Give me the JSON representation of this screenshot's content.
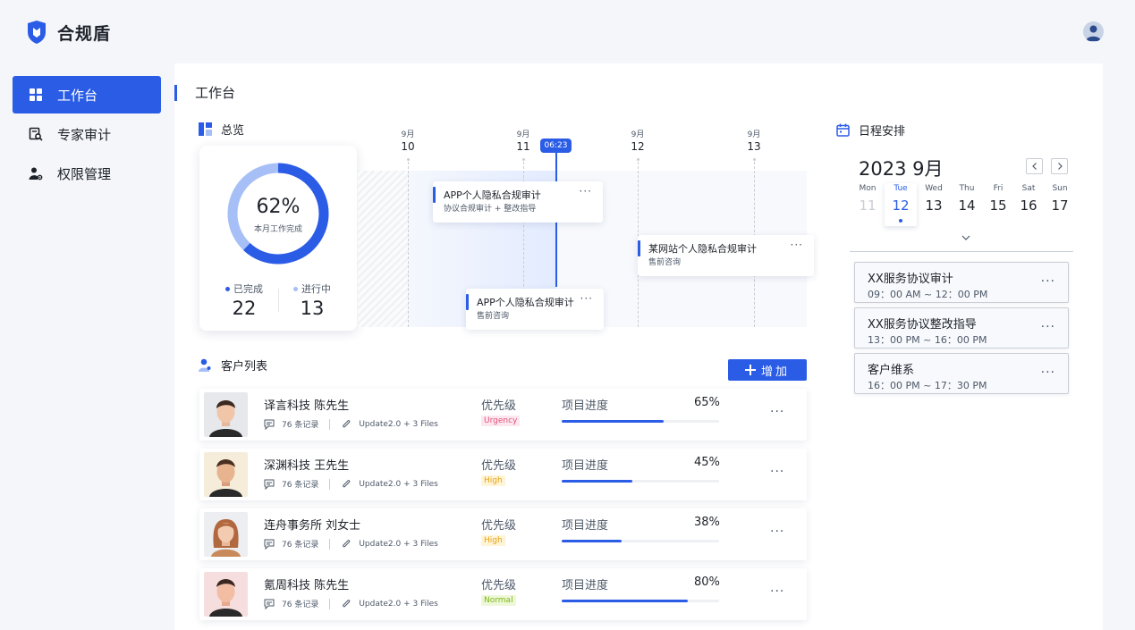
{
  "app": {
    "name": "合规盾"
  },
  "sidebar": {
    "items": [
      {
        "label": "工作台",
        "icon": "dashboard-icon",
        "active": true
      },
      {
        "label": "专家审计",
        "icon": "audit-icon",
        "active": false
      },
      {
        "label": "权限管理",
        "icon": "user-settings-icon",
        "active": false
      }
    ]
  },
  "page": {
    "title": "工作台"
  },
  "overview": {
    "title": "总览",
    "completion_pct": "62%",
    "completion_fraction": 0.62,
    "completion_label": "本月工作完成",
    "done_label": "已完成",
    "done_value": "22",
    "inprogress_label": "进行中",
    "inprogress_value": "13",
    "colors": {
      "done": "#2b5ce6",
      "inprogress": "#a7bff7"
    }
  },
  "timeline": {
    "dates": [
      {
        "month": "9月",
        "day": "10"
      },
      {
        "month": "9月",
        "day": "11"
      },
      {
        "month": "9月",
        "day": "12"
      },
      {
        "month": "9月",
        "day": "13"
      }
    ],
    "now": "06:23",
    "tasks": [
      {
        "title": "APP个人隐私合规审计",
        "sub": "协议合规审计 + 整改指导"
      },
      {
        "title": "某网站个人隐私合规审计",
        "sub": "售前咨询"
      },
      {
        "title": "APP个人隐私合规审计",
        "sub": "售前咨询"
      }
    ]
  },
  "clients": {
    "title": "客户列表",
    "add_label": "增加",
    "priority_label": "优先级",
    "progress_label": "项目进度",
    "rows": [
      {
        "name": "译言科技  陈先生",
        "records": "76 条记录",
        "files": "Update2.0 + 3 Files",
        "priority": "Urgency",
        "progress_pct": "65%",
        "progress": 0.65
      },
      {
        "name": "深渊科技  王先生",
        "records": "76 条记录",
        "files": "Update2.0 + 3 Files",
        "priority": "High",
        "progress_pct": "45%",
        "progress": 0.45
      },
      {
        "name": "连舟事务所  刘女士",
        "records": "76 条记录",
        "files": "Update2.0 + 3 Files",
        "priority": "High",
        "progress_pct": "38%",
        "progress": 0.38
      },
      {
        "name": "氪周科技  陈先生",
        "records": "76 条记录",
        "files": "Update2.0 + 3 Files",
        "priority": "Normal",
        "progress_pct": "80%",
        "progress": 0.8
      }
    ]
  },
  "schedule": {
    "title": "日程安排",
    "month_title": "2023 9月",
    "days": [
      {
        "name": "Mon",
        "date": "11",
        "muted": true
      },
      {
        "name": "Tue",
        "date": "12",
        "selected": true
      },
      {
        "name": "Wed",
        "date": "13"
      },
      {
        "name": "Thu",
        "date": "14"
      },
      {
        "name": "Fri",
        "date": "15"
      },
      {
        "name": "Sat",
        "date": "16"
      },
      {
        "name": "Sun",
        "date": "17"
      }
    ],
    "events": [
      {
        "title": "XX服务协议审计",
        "time": "09：00 AM ~ 12：00 PM"
      },
      {
        "title": "XX服务协议整改指导",
        "time": "13：00 PM ~ 16：00 PM"
      },
      {
        "title": "客户维系",
        "time": "16：00 PM ~ 17：30 PM"
      }
    ]
  }
}
